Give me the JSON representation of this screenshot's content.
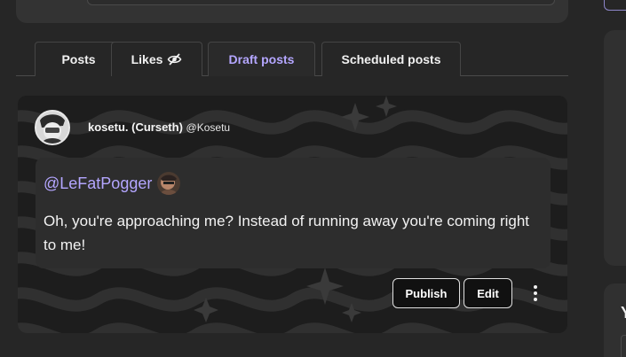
{
  "tabs": [
    {
      "label": "Posts",
      "active": false
    },
    {
      "label": "Likes",
      "active": false,
      "icon": "eye-slash-icon"
    },
    {
      "label": "Draft posts",
      "active": true
    },
    {
      "label": "Scheduled posts",
      "active": false
    }
  ],
  "post": {
    "author_name": "kosetu. (Curseth)",
    "author_handle": "@Kosetu",
    "mention": "@LeFatPogger",
    "text": "Oh, you're approaching me? Instead of running away you're coming right to me!",
    "actions": {
      "publish": "Publish",
      "edit": "Edit"
    }
  },
  "right": {
    "partial_letter": "Y"
  },
  "colors": {
    "accent": "#b4a6ff",
    "background": "#262626",
    "card": "#2d2d2d"
  }
}
